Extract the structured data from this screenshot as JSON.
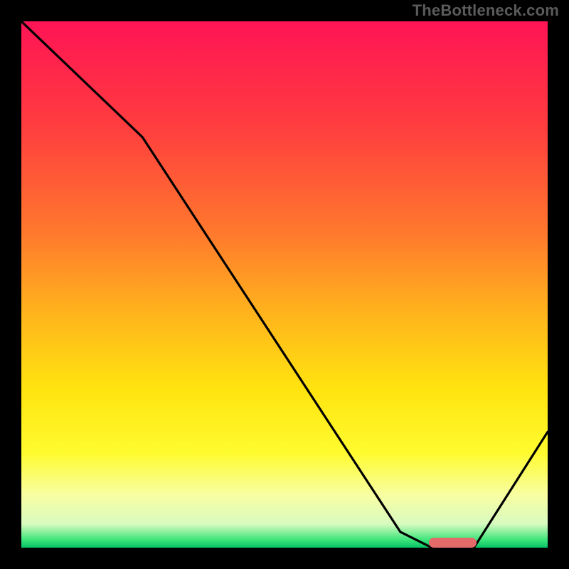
{
  "watermark": "TheBottleneck.com",
  "chart_data": {
    "type": "line",
    "title": "",
    "xlabel": "",
    "ylabel": "",
    "xlim": [
      0,
      100
    ],
    "ylim": [
      0,
      100
    ],
    "x": [
      0,
      23,
      72,
      78,
      86,
      100
    ],
    "values": [
      100,
      78,
      3,
      0,
      0,
      22
    ],
    "gradient_stops": [
      {
        "pos": 0.0,
        "color": "#ff1455"
      },
      {
        "pos": 0.2,
        "color": "#ff3d3f"
      },
      {
        "pos": 0.4,
        "color": "#ff782d"
      },
      {
        "pos": 0.55,
        "color": "#ffb21d"
      },
      {
        "pos": 0.7,
        "color": "#ffe40f"
      },
      {
        "pos": 0.82,
        "color": "#fffb2f"
      },
      {
        "pos": 0.9,
        "color": "#f8fea2"
      },
      {
        "pos": 0.955,
        "color": "#d8fbc0"
      },
      {
        "pos": 0.985,
        "color": "#3de57a"
      },
      {
        "pos": 1.0,
        "color": "#06c268"
      }
    ],
    "marker": {
      "x_start": 78,
      "x_end": 86,
      "y": 0,
      "color": "#e46a6a"
    }
  }
}
